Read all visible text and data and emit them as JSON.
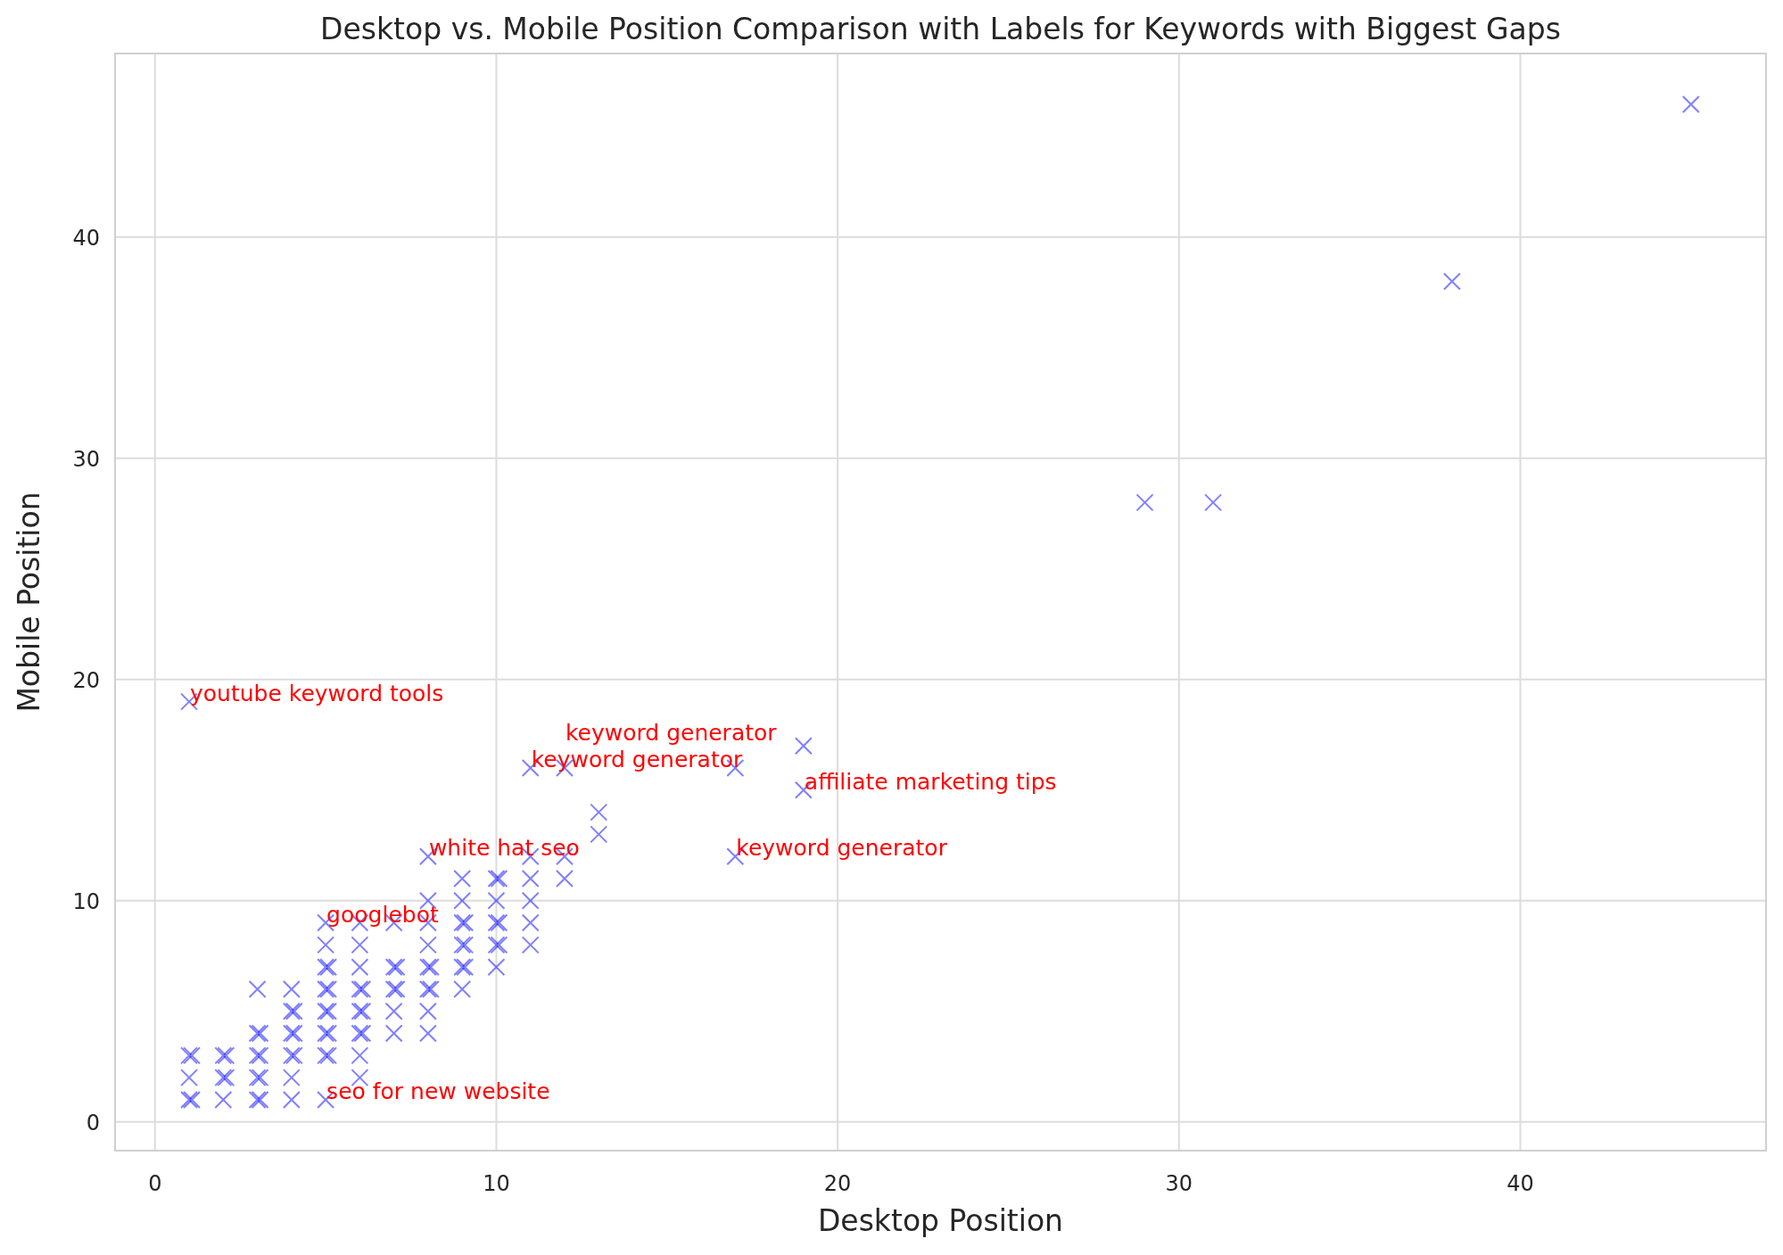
{
  "chart_data": {
    "type": "scatter",
    "title": "Desktop vs. Mobile Position Comparison with Labels for Keywords with Biggest Gaps",
    "xlabel": "Desktop Position",
    "ylabel": "Mobile Position",
    "grid": true,
    "xlim": [
      -1.17,
      47.2
    ],
    "ylim": [
      -1.3,
      48.3
    ],
    "xticks": [
      0,
      10,
      20,
      30,
      40
    ],
    "yticks": [
      0,
      10,
      20,
      30,
      40
    ],
    "x": [
      1,
      1,
      1,
      1,
      1,
      1,
      2,
      2,
      2,
      2,
      2,
      3,
      3,
      3,
      3,
      3,
      3,
      3,
      3,
      3,
      4,
      4,
      4,
      4,
      4,
      4,
      4,
      4,
      4,
      5,
      5,
      5,
      5,
      5,
      5,
      5,
      5,
      5,
      5,
      5,
      5,
      5,
      6,
      6,
      6,
      6,
      6,
      6,
      6,
      6,
      6,
      6,
      6,
      7,
      7,
      7,
      7,
      7,
      7,
      7,
      8,
      8,
      8,
      8,
      8,
      8,
      8,
      8,
      8,
      8,
      9,
      9,
      9,
      9,
      9,
      9,
      9,
      9,
      9,
      10,
      10,
      10,
      10,
      10,
      10,
      10,
      10,
      11,
      11,
      11,
      11,
      11,
      11,
      12,
      12,
      12,
      13,
      13,
      17,
      17,
      19,
      19,
      29,
      31,
      38,
      45
    ],
    "series": [
      {
        "color": "#0000ff",
        "values": [
          3,
          3,
          2,
          1,
          1,
          19,
          3,
          3,
          2,
          2,
          1,
          6,
          4,
          4,
          3,
          3,
          2,
          2,
          1,
          1,
          6,
          5,
          5,
          4,
          4,
          3,
          3,
          2,
          1,
          9,
          8,
          7,
          7,
          6,
          6,
          5,
          5,
          4,
          4,
          3,
          3,
          1,
          9,
          8,
          7,
          6,
          6,
          5,
          5,
          4,
          4,
          3,
          2,
          9,
          7,
          7,
          6,
          6,
          5,
          4,
          12,
          10,
          9,
          8,
          7,
          7,
          6,
          6,
          5,
          4,
          11,
          10,
          9,
          9,
          8,
          8,
          7,
          7,
          6,
          11,
          11,
          10,
          9,
          9,
          8,
          8,
          7,
          16,
          12,
          11,
          10,
          9,
          8,
          16,
          12,
          11,
          14,
          13,
          16,
          12,
          17,
          15,
          28,
          28,
          38,
          46
        ]
      }
    ],
    "annotations": [
      {
        "text": "youtube keyword tools",
        "x": 1,
        "y": 19
      },
      {
        "text": "keyword generator",
        "x": 11,
        "y": 16
      },
      {
        "text": "keyword generator",
        "x": 12,
        "y": 16
      },
      {
        "text": "affiliate marketing tips",
        "x": 19,
        "y": 15
      },
      {
        "text": "white hat seo",
        "x": 8,
        "y": 12
      },
      {
        "text": "keyword generator",
        "x": 17,
        "y": 12
      },
      {
        "text": "googlebot",
        "x": 5,
        "y": 9
      },
      {
        "text": "seo for new website",
        "x": 5,
        "y": 1
      }
    ]
  }
}
